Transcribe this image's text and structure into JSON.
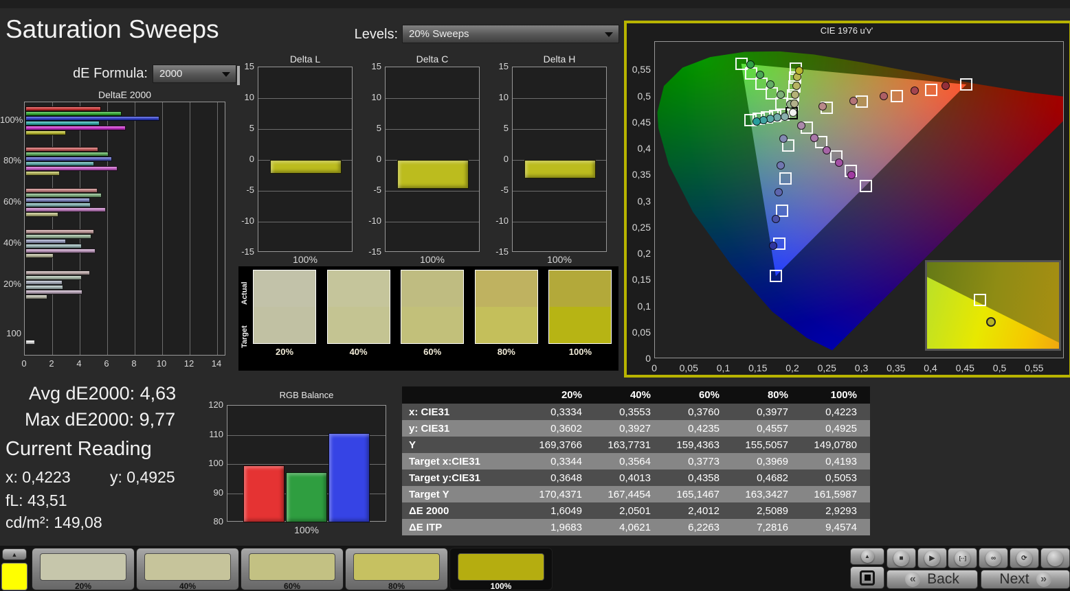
{
  "app": {
    "title": "Saturation Sweeps"
  },
  "colors": {
    "accent_yellow": "#b8b400",
    "background": "#292929",
    "panel_bg": "#1c1c1c"
  },
  "controls": {
    "de_formula_label": "dE Formula:",
    "de_formula_value": "2000",
    "levels_label": "Levels:",
    "levels_value": "20% Sweeps"
  },
  "readings": {
    "avg_label": "Avg dE2000: 4,63",
    "max_label": "Max dE2000: 9,77",
    "current_title": "Current Reading",
    "x": "x: 0,4223",
    "y": "y: 0,4925",
    "fl": "fL: 43,51",
    "cd": "cd/m²: 149,08"
  },
  "swatch_strip": {
    "actual_label": "Actual",
    "target_label": "Target",
    "items": [
      {
        "label": "20%",
        "actual": "#c2c2a9",
        "target": "#c1c1a3"
      },
      {
        "label": "40%",
        "actual": "#c5c59b",
        "target": "#c4c492"
      },
      {
        "label": "60%",
        "actual": "#bfbc81",
        "target": "#c2c07a"
      },
      {
        "label": "80%",
        "actual": "#bfb260",
        "target": "#c4bf5b"
      },
      {
        "label": "100%",
        "actual": "#b3a93a",
        "target": "#b7b414"
      }
    ]
  },
  "table": {
    "columns": [
      "20%",
      "40%",
      "60%",
      "80%",
      "100%"
    ],
    "rows": [
      {
        "label": "x: CIE31",
        "values": [
          "0,3334",
          "0,3553",
          "0,3760",
          "0,3977",
          "0,4223"
        ]
      },
      {
        "label": "y: CIE31",
        "values": [
          "0,3602",
          "0,3927",
          "0,4235",
          "0,4557",
          "0,4925"
        ]
      },
      {
        "label": "Y",
        "values": [
          "169,3766",
          "163,7731",
          "159,4363",
          "155,5057",
          "149,0780"
        ]
      },
      {
        "label": "Target x:CIE31",
        "values": [
          "0,3344",
          "0,3564",
          "0,3773",
          "0,3969",
          "0,4193"
        ]
      },
      {
        "label": "Target y:CIE31",
        "values": [
          "0,3648",
          "0,4013",
          "0,4358",
          "0,4682",
          "0,5053"
        ]
      },
      {
        "label": "Target Y",
        "values": [
          "170,4371",
          "167,4454",
          "165,1467",
          "163,3427",
          "161,5987"
        ]
      },
      {
        "label": "ΔE 2000",
        "values": [
          "1,6049",
          "2,0501",
          "2,4012",
          "2,5089",
          "2,9293"
        ]
      },
      {
        "label": "ΔE ITP",
        "values": [
          "1,9683",
          "4,0621",
          "6,2263",
          "7,2816",
          "9,4574"
        ]
      }
    ]
  },
  "bottom_bar": {
    "current_swatch_color": "#ffff00",
    "samples": [
      {
        "label": "20%",
        "color": "#c6c6ab",
        "selected": false
      },
      {
        "label": "40%",
        "color": "#c6c49b",
        "selected": false
      },
      {
        "label": "60%",
        "color": "#c3c183",
        "selected": false
      },
      {
        "label": "80%",
        "color": "#c6c161",
        "selected": false
      },
      {
        "label": "100%",
        "color": "#b5ad10",
        "selected": true
      }
    ],
    "transport_icons": [
      {
        "name": "stop-icon",
        "glyph": "■"
      },
      {
        "name": "play-icon",
        "glyph": "▶"
      },
      {
        "name": "pattern-window-icon",
        "glyph": "[··]"
      },
      {
        "name": "loop-icon",
        "glyph": "∞"
      },
      {
        "name": "refresh-icon",
        "glyph": "⟳"
      },
      {
        "name": "blank-icon",
        "glyph": ""
      }
    ],
    "back_chevron": "«",
    "back_label": "Back",
    "next_label": "Next",
    "next_chevron": "»"
  },
  "chart_data": [
    {
      "id": "deltae2000",
      "type": "bar",
      "orientation": "horizontal",
      "title": "DeltaE 2000",
      "xlim": [
        0,
        14.65
      ],
      "xticks": [
        0,
        2,
        4,
        6,
        8,
        10,
        12,
        14
      ],
      "series_names": [
        "Red",
        "Green",
        "Blue",
        "Cyan",
        "Magenta",
        "Yellow"
      ],
      "groups": [
        {
          "label": "100%",
          "values": [
            5.5,
            7.0,
            9.77,
            5.4,
            7.3,
            2.93
          ],
          "colors": [
            "#d22c2c",
            "#2cb02c",
            "#2c3cd2",
            "#2cb0b0",
            "#d22cd2",
            "#c2c22c"
          ]
        },
        {
          "label": "80%",
          "values": [
            5.3,
            6.05,
            6.3,
            5.0,
            6.7,
            2.51
          ],
          "colors": [
            "#cd5a5a",
            "#58ae58",
            "#5862cd",
            "#58aeae",
            "#cd5acd",
            "#bcbc58"
          ]
        },
        {
          "label": "60%",
          "values": [
            5.25,
            5.55,
            4.7,
            4.75,
            5.85,
            2.4
          ],
          "colors": [
            "#c98080",
            "#80b380",
            "#8088c9",
            "#80b3b3",
            "#c980c9",
            "#bcbc80"
          ]
        },
        {
          "label": "40%",
          "values": [
            5.0,
            4.8,
            2.95,
            4.1,
            5.1,
            2.05
          ],
          "colors": [
            "#c59c9c",
            "#9cba9c",
            "#9ca2c5",
            "#9cbaba",
            "#c59cc5",
            "#bcbc9c"
          ]
        },
        {
          "label": "20%",
          "values": [
            4.7,
            4.1,
            2.7,
            2.75,
            4.15,
            1.6
          ],
          "colors": [
            "#c2adad",
            "#adbead",
            "#adb2c2",
            "#adbebe",
            "#c2adc2",
            "#bebead"
          ]
        },
        {
          "label": "100",
          "values": [
            0.7
          ],
          "colors": [
            "#ececec"
          ]
        }
      ]
    },
    {
      "id": "delta_l",
      "type": "bar",
      "title": "Delta L",
      "categories": [
        "100%"
      ],
      "values": [
        -2.2
      ],
      "ylim": [
        -15,
        15
      ],
      "yticks": [
        15,
        10,
        5,
        0,
        -5,
        -10,
        -15
      ],
      "bar_color": "#bcbc1e"
    },
    {
      "id": "delta_c",
      "type": "bar",
      "title": "Delta C",
      "categories": [
        "100%"
      ],
      "values": [
        -4.7
      ],
      "ylim": [
        -15,
        15
      ],
      "yticks": [
        15,
        10,
        5,
        0,
        -5,
        -10,
        -15
      ],
      "bar_color": "#bcbc1e"
    },
    {
      "id": "delta_h",
      "type": "bar",
      "title": "Delta H",
      "categories": [
        "100%"
      ],
      "values": [
        -3.0
      ],
      "ylim": [
        -15,
        15
      ],
      "yticks": [
        15,
        10,
        5,
        0,
        -5,
        -10,
        -15
      ],
      "bar_color": "#bcbc1e"
    },
    {
      "id": "rgb_balance",
      "type": "bar",
      "title": "RGB Balance",
      "categories": [
        "Red",
        "Green",
        "Blue"
      ],
      "values": [
        99.5,
        97.2,
        110.6
      ],
      "colors": [
        "#e53333",
        "#2f9e40",
        "#3644e5"
      ],
      "ylim": [
        80,
        120
      ],
      "yticks": [
        120,
        110,
        100,
        90,
        80
      ],
      "xlabel": "100%"
    },
    {
      "id": "cie_diagram",
      "type": "scatter",
      "title": "CIE 1976 u'v'",
      "xlim": [
        0,
        0.593
      ],
      "ylim": [
        0,
        0.604
      ],
      "xticks": [
        "0",
        "0,05",
        "0,1",
        "0,15",
        "0,2",
        "0,25",
        "0,3",
        "0,35",
        "0,4",
        "0,45",
        "0,5",
        "0,55"
      ],
      "yticks": [
        "0",
        "0,05",
        "0,1",
        "0,15",
        "0,2",
        "0,25",
        "0,3",
        "0,35",
        "0,4",
        "0,45",
        "0,5",
        "0,55"
      ],
      "gamut_triangle": {
        "red": [
          0.451,
          0.523
        ],
        "green": [
          0.125,
          0.5625
        ],
        "blue": [
          0.175,
          0.158
        ]
      },
      "spectral_locus": [
        [
          0.2568,
          0.0165
        ],
        [
          0.22,
          0.04
        ],
        [
          0.17,
          0.09
        ],
        [
          0.11,
          0.18
        ],
        [
          0.055,
          0.28
        ],
        [
          0.02,
          0.37
        ],
        [
          0.005,
          0.44
        ],
        [
          0.0035,
          0.47
        ],
        [
          0.013,
          0.52
        ],
        [
          0.04,
          0.555
        ],
        [
          0.08,
          0.575
        ],
        [
          0.13,
          0.585
        ],
        [
          0.18,
          0.586
        ],
        [
          0.23,
          0.58
        ],
        [
          0.3,
          0.565
        ],
        [
          0.38,
          0.545
        ],
        [
          0.46,
          0.525
        ],
        [
          0.54,
          0.508
        ],
        [
          0.623,
          0.495
        ]
      ],
      "white_point": {
        "target": [
          0.198,
          0.468
        ],
        "measured": [
          0.1995,
          0.4695
        ]
      },
      "series": [
        {
          "name": "red",
          "targets": [
            [
              0.2486,
              0.479
            ],
            [
              0.2992,
              0.49
            ],
            [
              0.3498,
              0.501
            ],
            [
              0.4004,
              0.512
            ],
            [
              0.451,
              0.523
            ]
          ],
          "measured": [
            [
              0.2425,
              0.4817
            ],
            [
              0.2871,
              0.4914
            ],
            [
              0.3316,
              0.501
            ],
            [
              0.3761,
              0.5107
            ],
            [
              0.4206,
              0.5204
            ]
          ],
          "point_colors": [
            "#b98989",
            "#b37478",
            "#ad5f65",
            "#a4454f",
            "#942f3a"
          ]
        },
        {
          "name": "green",
          "targets": [
            [
              0.1834,
              0.4869
            ],
            [
              0.1688,
              0.5058
            ],
            [
              0.1542,
              0.5247
            ],
            [
              0.1396,
              0.5436
            ],
            [
              0.125,
              0.5625
            ]
          ],
          "measured": [
            [
              0.1964,
              0.4849
            ],
            [
              0.1818,
              0.5038
            ],
            [
              0.1672,
              0.5227
            ],
            [
              0.1526,
              0.5416
            ],
            [
              0.138,
              0.5605
            ]
          ],
          "point_colors": [
            "#93b289",
            "#7cb077",
            "#63ad66",
            "#4aa854",
            "#30a245"
          ]
        },
        {
          "name": "blue",
          "targets": [
            [
              0.1934,
              0.406
            ],
            [
              0.1888,
              0.344
            ],
            [
              0.1842,
              0.282
            ],
            [
              0.1796,
              0.22
            ],
            [
              0.175,
              0.158
            ]
          ],
          "measured": [
            [
              0.1862,
              0.4194
            ],
            [
              0.1825,
              0.3685
            ],
            [
              0.1787,
              0.3177
            ],
            [
              0.1749,
              0.2668
            ],
            [
              0.1711,
              0.216
            ]
          ],
          "point_colors": [
            "#8289b2",
            "#7077b0",
            "#5d65ad",
            "#4a51a8",
            "#2f36a0"
          ]
        },
        {
          "name": "cyan",
          "targets": [
            [
              0.186,
              0.4654
            ],
            [
              0.174,
              0.4628
            ],
            [
              0.162,
              0.4602
            ],
            [
              0.15,
              0.4576
            ],
            [
              0.138,
              0.455
            ]
          ],
          "measured": [
            [
              0.1878,
              0.4618
            ],
            [
              0.1776,
              0.4596
            ],
            [
              0.1674,
              0.4574
            ],
            [
              0.1572,
              0.4552
            ],
            [
              0.147,
              0.453
            ]
          ],
          "point_colors": [
            "#89aeac",
            "#72aba9",
            "#5aa8a6",
            "#41a4a2",
            "#279e9c"
          ]
        },
        {
          "name": "magenta",
          "targets": [
            [
              0.2194,
              0.4404
            ],
            [
              0.2408,
              0.4128
            ],
            [
              0.2622,
              0.3852
            ],
            [
              0.2836,
              0.3576
            ],
            [
              0.305,
              0.33
            ]
          ],
          "measured": [
            [
              0.2122,
              0.4445
            ],
            [
              0.2304,
              0.4211
            ],
            [
              0.2486,
              0.3976
            ],
            [
              0.2668,
              0.3742
            ],
            [
              0.285,
              0.3507
            ]
          ],
          "point_colors": [
            "#ab89aa",
            "#a977a9",
            "#a765a7",
            "#a450a5",
            "#a03aa2"
          ]
        },
        {
          "name": "yellow",
          "targets": [
            [
              0.1992,
              0.485
            ],
            [
              0.2004,
              0.502
            ],
            [
              0.2016,
              0.519
            ],
            [
              0.2028,
              0.536
            ],
            [
              0.204,
              0.553
            ]
          ],
          "measured": [
            [
              0.2022,
              0.486
            ],
            [
              0.2034,
              0.503
            ],
            [
              0.2046,
              0.52
            ],
            [
              0.2058,
              0.537
            ],
            [
              0.2094,
              0.5496
            ]
          ],
          "point_colors": [
            "#b2b18b",
            "#b4b277",
            "#b6b463",
            "#b8b64e",
            "#bab72f"
          ]
        }
      ],
      "inset": {
        "target_frac": [
          0.4,
          0.44
        ],
        "measured_frac": [
          0.485,
          0.69
        ],
        "measured_color": "#b8b426"
      }
    }
  ]
}
